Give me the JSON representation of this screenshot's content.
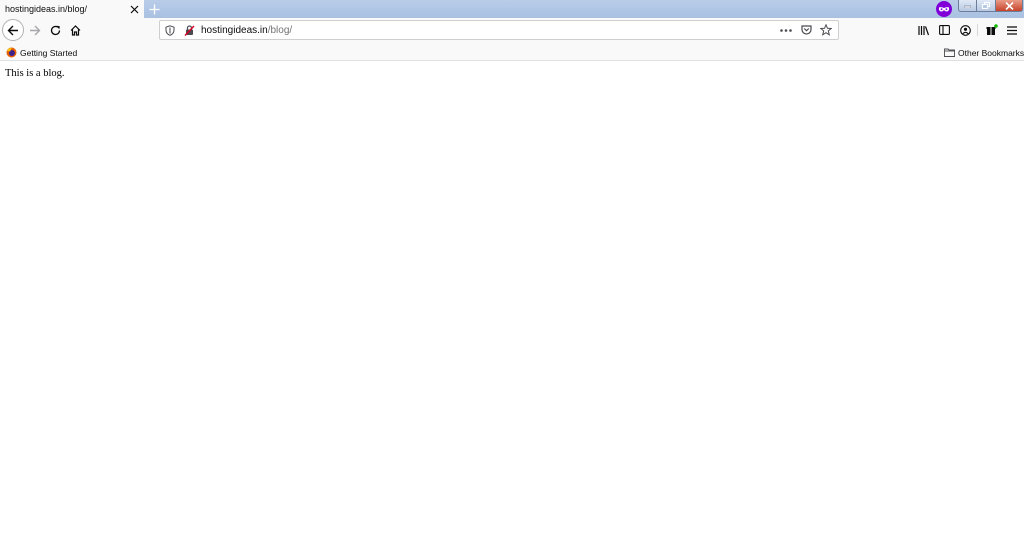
{
  "tab": {
    "title": "hostingideas.in/blog/"
  },
  "urlbar": {
    "host": "hostingideas.in",
    "path": "/blog/"
  },
  "bookmarks": [
    {
      "label": "Getting Started",
      "icon": "firefox-icon"
    },
    {
      "label": "Other Bookmarks",
      "icon": "folder-icon"
    }
  ],
  "page": {
    "text": "This is a blog."
  },
  "colors": {
    "private_browsing": "#8000d7",
    "toolbar_bg": "#f9f9fa",
    "titlebar_bg": "#b3c8e6",
    "close_button": "#c7432c"
  }
}
